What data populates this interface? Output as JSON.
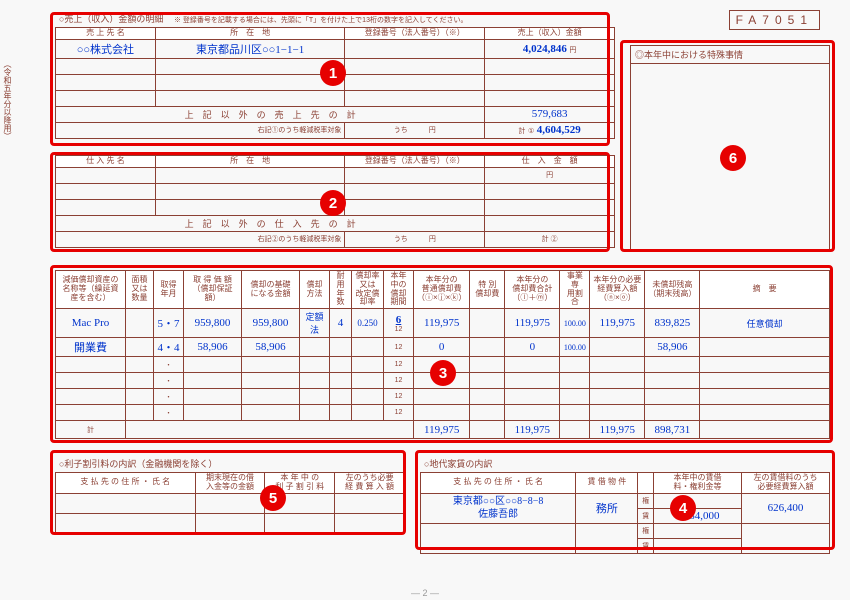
{
  "form_code": "FA7051",
  "side_label": "（令和五年分以降用）",
  "page_num": "— 2 —",
  "sec1": {
    "title": "○売上（収入）金額の明細",
    "note": "※ 登録番号を記載する場合には、先頭に「T」を付けた上で13桁の数字を記入してください。",
    "h_name": "売 上 先 名",
    "h_addr": "所　在　地",
    "h_reg": "登録番号（法人番号）（※）",
    "h_amt": "売上（収入）金額",
    "r1_name": "○○株式会社",
    "r1_addr": "東京都品川区○○1−1−1",
    "r1_amt": "4,024,846",
    "unit": "円",
    "other_label": "上　記　以　外　の　売　上　先　の　計",
    "other_amt": "579,683",
    "reduced_label": "右記①のうち軽減税率対象",
    "reduced_u": "うち",
    "reduced_y": "円",
    "total_label": "計",
    "total_mark": "①",
    "total_amt": "4,604,529"
  },
  "sec2": {
    "h_name": "仕 入 先 名",
    "h_addr": "所　在　地",
    "h_reg": "登録番号（法人番号）（※）",
    "h_amt": "仕　入　金　額",
    "unit": "円",
    "other_label": "上　記　以　外　の　仕　入　先　の　計",
    "reduced_label": "右記②のうち軽減税率対象",
    "reduced_u": "うち",
    "reduced_y": "円",
    "total_label": "計",
    "total_mark": "②"
  },
  "sec3": {
    "h1": "減価償却資産の名称等（繰延資産を含む）",
    "h2": "面積又は数量",
    "h3": "取得年月",
    "h4a": "取 得 価 額",
    "h4b": "（償却保証額）",
    "h5a": "償却の基礎",
    "h5b": "になる金額",
    "h6": "償却方法",
    "h7": "耐用年数",
    "h8a": "償却率又は",
    "h8b": "改定償却率",
    "h9a": "本年中の",
    "h9b": "償却期間",
    "h10a": "本年分の",
    "h10b": "普通償却費",
    "h10c": "（ⓘ×ⓙ×ⓚ）",
    "h11a": "特 別",
    "h11b": "償却費",
    "h12a": "本年分の",
    "h12b": "償却費合計",
    "h12c": "（ⓛ＋ⓜ）",
    "h13a": "事業専",
    "h13b": "用割合",
    "h14a": "本年分の必要",
    "h14b": "経費算入額",
    "h14c": "（ⓝ×ⓞ）",
    "h15a": "未償却残高",
    "h15b": "（期末残高）",
    "h16": "摘　要",
    "r1_name": "Mac Pro",
    "r1_date": "5・7",
    "r1_acq": "959,800",
    "r1_base": "959,800",
    "r1_method": "定額法",
    "r1_life": "4",
    "r1_rate": "0.250",
    "r1_months": "6",
    "r1_m12": "12",
    "r1_dep": "119,975",
    "r1_total": "119,975",
    "r1_ratio": "100.00",
    "r1_exp": "119,975",
    "r1_bal": "839,825",
    "r1_note": "任意償却",
    "r2_name": "開業費",
    "r2_date": "4・4",
    "r2_acq": "58,906",
    "r2_base": "58,906",
    "r2_m12": "12",
    "r2_dep": "0",
    "r2_total": "0",
    "r2_ratio": "100.00",
    "r2_bal": "58,906",
    "dot": "・",
    "m12": "12",
    "sum_label": "計",
    "sum_dep": "119,975",
    "sum_total": "119,975",
    "sum_exp": "119,975",
    "sum_bal": "898,731"
  },
  "sec5": {
    "title": "○利子割引料の内訳（金融機関を除く）",
    "h1": "支 払 先 の 住 所 ・ 氏 名",
    "h2a": "期末現在の借",
    "h2b": "入金等の金額",
    "h3a": "本 年 中 の",
    "h3b": "利 子 割 引 料",
    "h4a": "左のうち必要",
    "h4b": "経 費 算 入 額"
  },
  "sec4": {
    "title": "○地代家賃の内訳",
    "h1": "支 払 先 の 住 所 ・ 氏 名",
    "h2": "賃 借 物 件",
    "h3a": "本年中の賃借",
    "h3b": "料・権利金等",
    "h4a": "左の賃借料のうち",
    "h4b": "必要経費算入額",
    "r1_addr": "東京都○○区○○8−8−8",
    "r1_name": "佐藤吾郎",
    "r1_obj": "務所",
    "r1_sub_k": "権",
    "r1_sub_c": "賃",
    "r1_rent": "2,784,000",
    "r1_exp": "626,400"
  },
  "sec6": {
    "title": "◎本年中における特殊事情"
  },
  "badges": {
    "b1": "1",
    "b2": "2",
    "b3": "3",
    "b4": "4",
    "b5": "5",
    "b6": "6"
  }
}
